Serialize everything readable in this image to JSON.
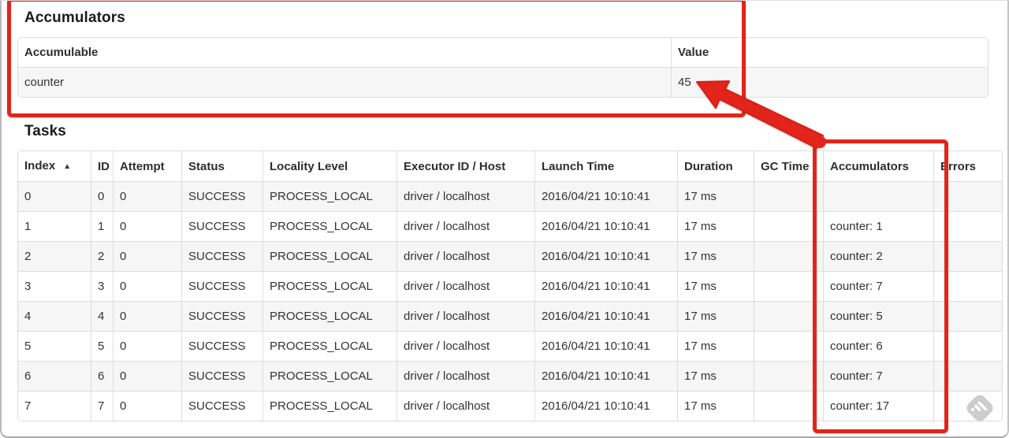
{
  "annotation": {
    "color": "#e2251b",
    "purpose": "highlight accumulators"
  },
  "accumulators_section": {
    "title": "Accumulators",
    "table": {
      "headers": [
        "Accumulable",
        "Value"
      ],
      "rows": [
        [
          "counter",
          "45"
        ]
      ]
    }
  },
  "tasks_section": {
    "title": "Tasks",
    "table": {
      "headers": [
        "Index",
        "ID",
        "Attempt",
        "Status",
        "Locality Level",
        "Executor ID / Host",
        "Launch Time",
        "Duration",
        "GC Time",
        "Accumulators",
        "Errors"
      ],
      "sort_column": "Index",
      "sort_indicator": "▲",
      "rows": [
        [
          "0",
          "0",
          "0",
          "SUCCESS",
          "PROCESS_LOCAL",
          "driver / localhost",
          "2016/04/21 10:10:41",
          "17 ms",
          "",
          "",
          ""
        ],
        [
          "1",
          "1",
          "0",
          "SUCCESS",
          "PROCESS_LOCAL",
          "driver / localhost",
          "2016/04/21 10:10:41",
          "17 ms",
          "",
          "counter: 1",
          ""
        ],
        [
          "2",
          "2",
          "0",
          "SUCCESS",
          "PROCESS_LOCAL",
          "driver / localhost",
          "2016/04/21 10:10:41",
          "17 ms",
          "",
          "counter: 2",
          ""
        ],
        [
          "3",
          "3",
          "0",
          "SUCCESS",
          "PROCESS_LOCAL",
          "driver / localhost",
          "2016/04/21 10:10:41",
          "17 ms",
          "",
          "counter: 7",
          ""
        ],
        [
          "4",
          "4",
          "0",
          "SUCCESS",
          "PROCESS_LOCAL",
          "driver / localhost",
          "2016/04/21 10:10:41",
          "17 ms",
          "",
          "counter: 5",
          ""
        ],
        [
          "5",
          "5",
          "0",
          "SUCCESS",
          "PROCESS_LOCAL",
          "driver / localhost",
          "2016/04/21 10:10:41",
          "17 ms",
          "",
          "counter: 6",
          ""
        ],
        [
          "6",
          "6",
          "0",
          "SUCCESS",
          "PROCESS_LOCAL",
          "driver / localhost",
          "2016/04/21 10:10:41",
          "17 ms",
          "",
          "counter: 7",
          ""
        ],
        [
          "7",
          "7",
          "0",
          "SUCCESS",
          "PROCESS_LOCAL",
          "driver / localhost",
          "2016/04/21 10:10:41",
          "17 ms",
          "",
          "counter: 17",
          ""
        ]
      ]
    }
  },
  "icons": {
    "watermark": "skitch-watermark-icon",
    "sort": "sort-ascending-icon"
  }
}
